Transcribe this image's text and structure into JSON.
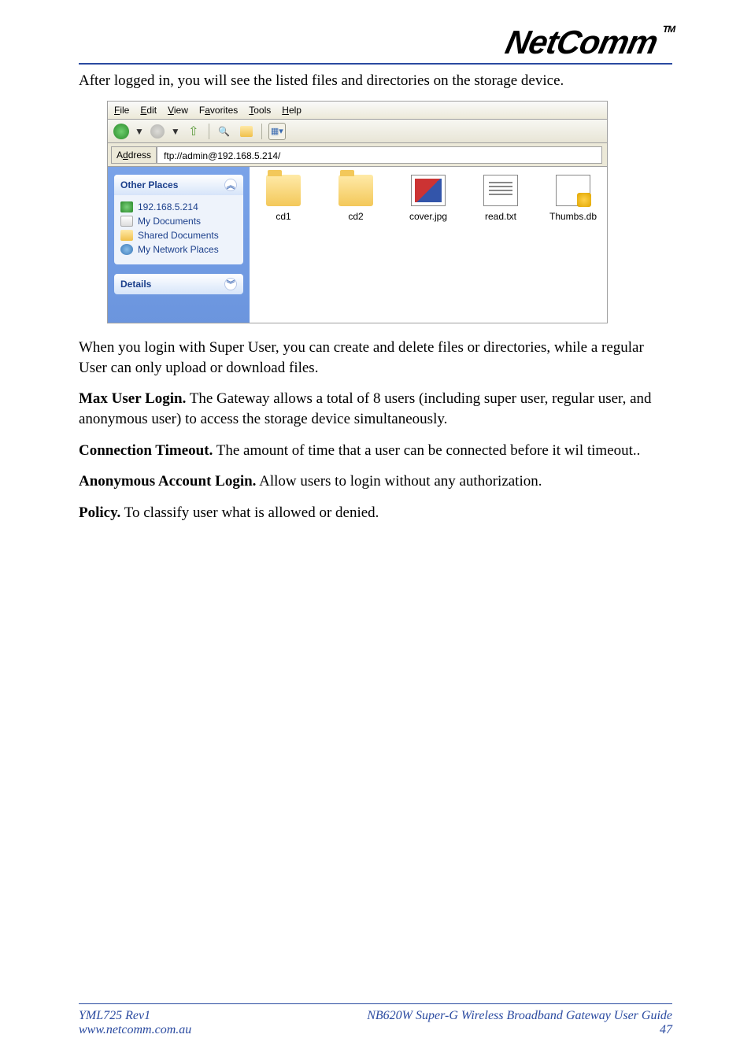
{
  "logo": {
    "text": "NetComm",
    "tm": "TM"
  },
  "intro": "After logged in, you will see the listed files and directories on the storage device.",
  "screenshot": {
    "menubar": [
      "File",
      "Edit",
      "View",
      "Favorites",
      "Tools",
      "Help"
    ],
    "menubar_accel": [
      "F",
      "E",
      "V",
      "a",
      "T",
      "H"
    ],
    "address_label": "Address",
    "address_value": "ftp://admin@192.168.5.214/",
    "sidebar": {
      "other_places": {
        "title": "Other Places",
        "items": [
          "192.168.5.214",
          "My Documents",
          "Shared Documents",
          "My Network Places"
        ]
      },
      "details": {
        "title": "Details"
      }
    },
    "files": [
      {
        "name": "cd1",
        "type": "folder"
      },
      {
        "name": "cd2",
        "type": "folder"
      },
      {
        "name": "cover.jpg",
        "type": "image"
      },
      {
        "name": "read.txt",
        "type": "text"
      },
      {
        "name": "Thumbs.db",
        "type": "db"
      }
    ]
  },
  "paragraphs": {
    "p1": "When you login with Super User, you can create and delete files or directories, while a regular User can only upload or download files.",
    "p2a": "Max User Login.",
    "p2b": " The Gateway allows a total of 8 users (including super user, regular user, and anonymous user) to access the storage device simultaneously.",
    "p3a": "Connection Timeout.",
    "p3b": " The amount of time that a user can be connected before it wil timeout..",
    "p4a": "Anonymous Account Login.",
    "p4b": " Allow users to login without any authorization.",
    "p5a": "Policy.",
    "p5b": " To classify user what is allowed or denied."
  },
  "footer": {
    "left1": "YML725 Rev1",
    "left2": "www.netcomm.com.au",
    "right1": "NB620W Super-G Wireless Broadband  Gateway User Guide",
    "right2": "47"
  }
}
